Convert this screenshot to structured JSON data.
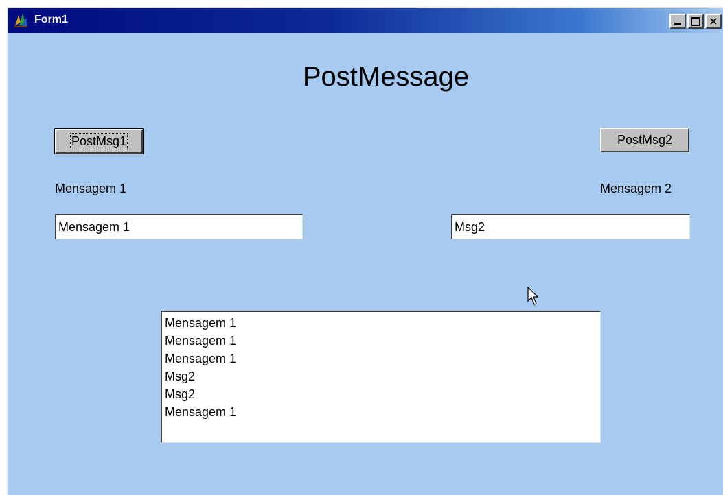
{
  "window": {
    "title": "Form1",
    "close_glyph": "×",
    "icon": "delphi-app-icon"
  },
  "heading": "PostMessage",
  "buttons": {
    "post1_label": "PostMsg1",
    "post2_label": "PostMsg2"
  },
  "labels": {
    "msg1": "Mensagem 1",
    "msg2": "Mensagem 2"
  },
  "inputs": {
    "msg1_value": "Mensagem 1",
    "msg2_value": "Msg2"
  },
  "listbox": {
    "items": [
      "Mensagem 1",
      "Mensagem 1",
      "Mensagem 1",
      "Msg2",
      "Msg2",
      "Mensagem 1"
    ]
  },
  "colors": {
    "form_background": "#a6caf0",
    "titlebar_start": "#000a80",
    "button_face": "#c0c0c0"
  }
}
